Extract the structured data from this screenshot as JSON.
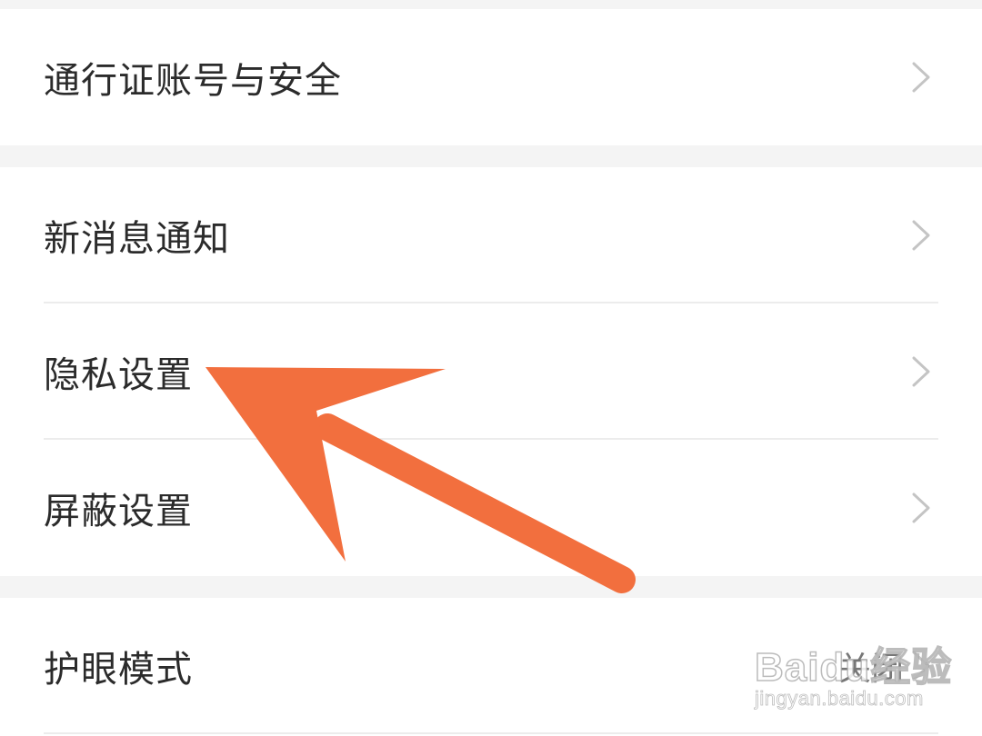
{
  "settings": {
    "account_security": {
      "label": "通行证账号与安全"
    },
    "notifications": {
      "label": "新消息通知"
    },
    "privacy": {
      "label": "隐私设置"
    },
    "block": {
      "label": "屏蔽设置"
    },
    "eye_care": {
      "label": "护眼模式",
      "value": "关闭"
    }
  },
  "annotation": {
    "arrow_color": "#f26f3e",
    "target": "隐私设置"
  },
  "watermark": {
    "brand": "Baidu经验",
    "url": "jingyan.baidu.com"
  },
  "colors": {
    "background": "#f4f4f4",
    "row_background": "#ffffff",
    "label_text": "#2b2b2b",
    "chevron": "#c4c4c4",
    "divider": "#ececec"
  },
  "icons": {
    "chevron": "chevron-right-icon"
  }
}
